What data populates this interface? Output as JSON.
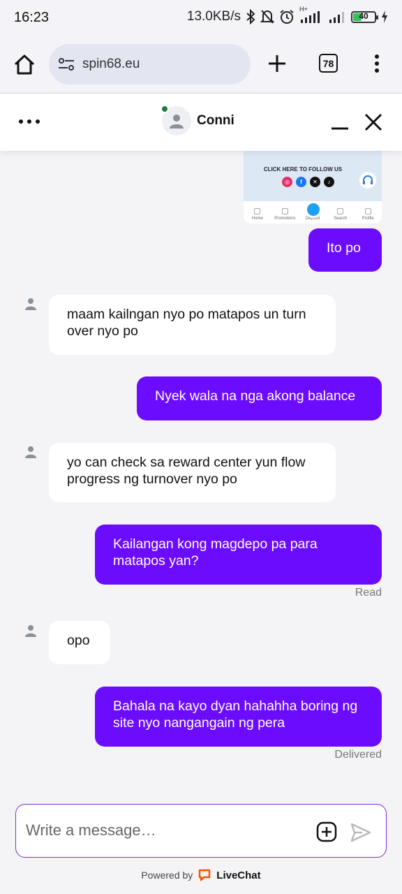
{
  "status_bar": {
    "time": "16:23",
    "net_speed": "13.0KB/s",
    "network_label": "H+",
    "battery_level": "40",
    "battery_percent": 40,
    "icons": [
      "bluetooth-icon",
      "mute-bell-icon",
      "alarm-icon",
      "signal-icon",
      "signal-icon",
      "battery-icon",
      "charging-icon"
    ]
  },
  "browser": {
    "url": "spin68.eu",
    "tab_count": "78",
    "icons": [
      "home-icon",
      "site-settings-icon",
      "new-tab-icon",
      "more-vert-icon"
    ]
  },
  "chat_header": {
    "agent_name": "Conni",
    "agent_status": "online",
    "icons": [
      "more-horizontal-icon",
      "minimize-icon",
      "close-icon"
    ]
  },
  "shared_image": {
    "follow_text": "CLICK HERE TO FOLLOW US",
    "nav": [
      "Home",
      "Promotions",
      "Deposit",
      "Search",
      "Profile"
    ]
  },
  "messages": [
    {
      "from": "visitor",
      "text": "Ito po"
    },
    {
      "from": "agent",
      "text": "maam kailngan nyo po matapos un turn over nyo po"
    },
    {
      "from": "visitor",
      "text": "Nyek wala na nga akong balance"
    },
    {
      "from": "agent",
      "text": "yo can check sa reward center yun flow progress ng turnover nyo po"
    },
    {
      "from": "visitor",
      "text": "Kailangan kong magdepo pa para matapos yan?",
      "receipt": "Read"
    },
    {
      "from": "agent",
      "text": "opo"
    },
    {
      "from": "visitor",
      "text": "Bahala na kayo dyan hahahha boring ng site nyo nangangain ng pera",
      "receipt": "Delivered"
    }
  ],
  "composer": {
    "placeholder": "Write a message…",
    "icons": [
      "attach-plus-icon",
      "send-icon"
    ]
  },
  "footer": {
    "powered_by": "Powered by",
    "brand": "LiveChat"
  },
  "colors": {
    "accent": "#6c0cff",
    "composer_border": "#7b2fd6",
    "online": "#1f7a3e",
    "brand_logo": "#ff5100"
  }
}
